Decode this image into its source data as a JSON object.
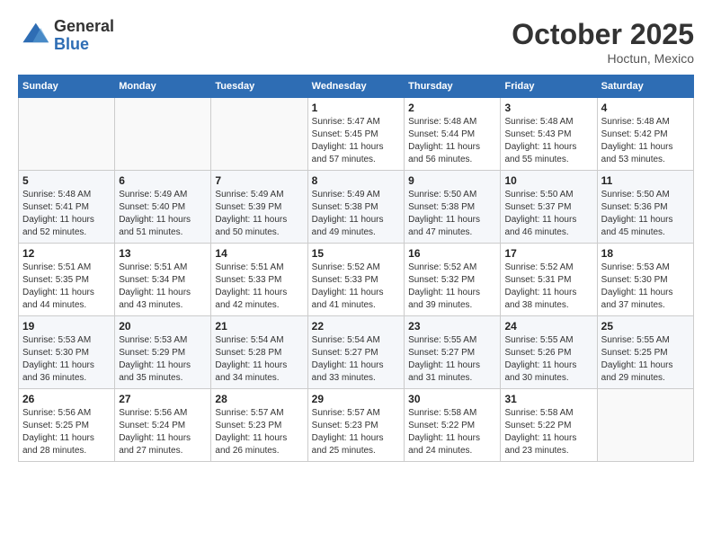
{
  "header": {
    "logo_general": "General",
    "logo_blue": "Blue",
    "month": "October 2025",
    "location": "Hoctun, Mexico"
  },
  "weekdays": [
    "Sunday",
    "Monday",
    "Tuesday",
    "Wednesday",
    "Thursday",
    "Friday",
    "Saturday"
  ],
  "weeks": [
    [
      {
        "day": "",
        "info": ""
      },
      {
        "day": "",
        "info": ""
      },
      {
        "day": "",
        "info": ""
      },
      {
        "day": "1",
        "info": "Sunrise: 5:47 AM\nSunset: 5:45 PM\nDaylight: 11 hours and 57 minutes."
      },
      {
        "day": "2",
        "info": "Sunrise: 5:48 AM\nSunset: 5:44 PM\nDaylight: 11 hours and 56 minutes."
      },
      {
        "day": "3",
        "info": "Sunrise: 5:48 AM\nSunset: 5:43 PM\nDaylight: 11 hours and 55 minutes."
      },
      {
        "day": "4",
        "info": "Sunrise: 5:48 AM\nSunset: 5:42 PM\nDaylight: 11 hours and 53 minutes."
      }
    ],
    [
      {
        "day": "5",
        "info": "Sunrise: 5:48 AM\nSunset: 5:41 PM\nDaylight: 11 hours and 52 minutes."
      },
      {
        "day": "6",
        "info": "Sunrise: 5:49 AM\nSunset: 5:40 PM\nDaylight: 11 hours and 51 minutes."
      },
      {
        "day": "7",
        "info": "Sunrise: 5:49 AM\nSunset: 5:39 PM\nDaylight: 11 hours and 50 minutes."
      },
      {
        "day": "8",
        "info": "Sunrise: 5:49 AM\nSunset: 5:38 PM\nDaylight: 11 hours and 49 minutes."
      },
      {
        "day": "9",
        "info": "Sunrise: 5:50 AM\nSunset: 5:38 PM\nDaylight: 11 hours and 47 minutes."
      },
      {
        "day": "10",
        "info": "Sunrise: 5:50 AM\nSunset: 5:37 PM\nDaylight: 11 hours and 46 minutes."
      },
      {
        "day": "11",
        "info": "Sunrise: 5:50 AM\nSunset: 5:36 PM\nDaylight: 11 hours and 45 minutes."
      }
    ],
    [
      {
        "day": "12",
        "info": "Sunrise: 5:51 AM\nSunset: 5:35 PM\nDaylight: 11 hours and 44 minutes."
      },
      {
        "day": "13",
        "info": "Sunrise: 5:51 AM\nSunset: 5:34 PM\nDaylight: 11 hours and 43 minutes."
      },
      {
        "day": "14",
        "info": "Sunrise: 5:51 AM\nSunset: 5:33 PM\nDaylight: 11 hours and 42 minutes."
      },
      {
        "day": "15",
        "info": "Sunrise: 5:52 AM\nSunset: 5:33 PM\nDaylight: 11 hours and 41 minutes."
      },
      {
        "day": "16",
        "info": "Sunrise: 5:52 AM\nSunset: 5:32 PM\nDaylight: 11 hours and 39 minutes."
      },
      {
        "day": "17",
        "info": "Sunrise: 5:52 AM\nSunset: 5:31 PM\nDaylight: 11 hours and 38 minutes."
      },
      {
        "day": "18",
        "info": "Sunrise: 5:53 AM\nSunset: 5:30 PM\nDaylight: 11 hours and 37 minutes."
      }
    ],
    [
      {
        "day": "19",
        "info": "Sunrise: 5:53 AM\nSunset: 5:30 PM\nDaylight: 11 hours and 36 minutes."
      },
      {
        "day": "20",
        "info": "Sunrise: 5:53 AM\nSunset: 5:29 PM\nDaylight: 11 hours and 35 minutes."
      },
      {
        "day": "21",
        "info": "Sunrise: 5:54 AM\nSunset: 5:28 PM\nDaylight: 11 hours and 34 minutes."
      },
      {
        "day": "22",
        "info": "Sunrise: 5:54 AM\nSunset: 5:27 PM\nDaylight: 11 hours and 33 minutes."
      },
      {
        "day": "23",
        "info": "Sunrise: 5:55 AM\nSunset: 5:27 PM\nDaylight: 11 hours and 31 minutes."
      },
      {
        "day": "24",
        "info": "Sunrise: 5:55 AM\nSunset: 5:26 PM\nDaylight: 11 hours and 30 minutes."
      },
      {
        "day": "25",
        "info": "Sunrise: 5:55 AM\nSunset: 5:25 PM\nDaylight: 11 hours and 29 minutes."
      }
    ],
    [
      {
        "day": "26",
        "info": "Sunrise: 5:56 AM\nSunset: 5:25 PM\nDaylight: 11 hours and 28 minutes."
      },
      {
        "day": "27",
        "info": "Sunrise: 5:56 AM\nSunset: 5:24 PM\nDaylight: 11 hours and 27 minutes."
      },
      {
        "day": "28",
        "info": "Sunrise: 5:57 AM\nSunset: 5:23 PM\nDaylight: 11 hours and 26 minutes."
      },
      {
        "day": "29",
        "info": "Sunrise: 5:57 AM\nSunset: 5:23 PM\nDaylight: 11 hours and 25 minutes."
      },
      {
        "day": "30",
        "info": "Sunrise: 5:58 AM\nSunset: 5:22 PM\nDaylight: 11 hours and 24 minutes."
      },
      {
        "day": "31",
        "info": "Sunrise: 5:58 AM\nSunset: 5:22 PM\nDaylight: 11 hours and 23 minutes."
      },
      {
        "day": "",
        "info": ""
      }
    ]
  ]
}
